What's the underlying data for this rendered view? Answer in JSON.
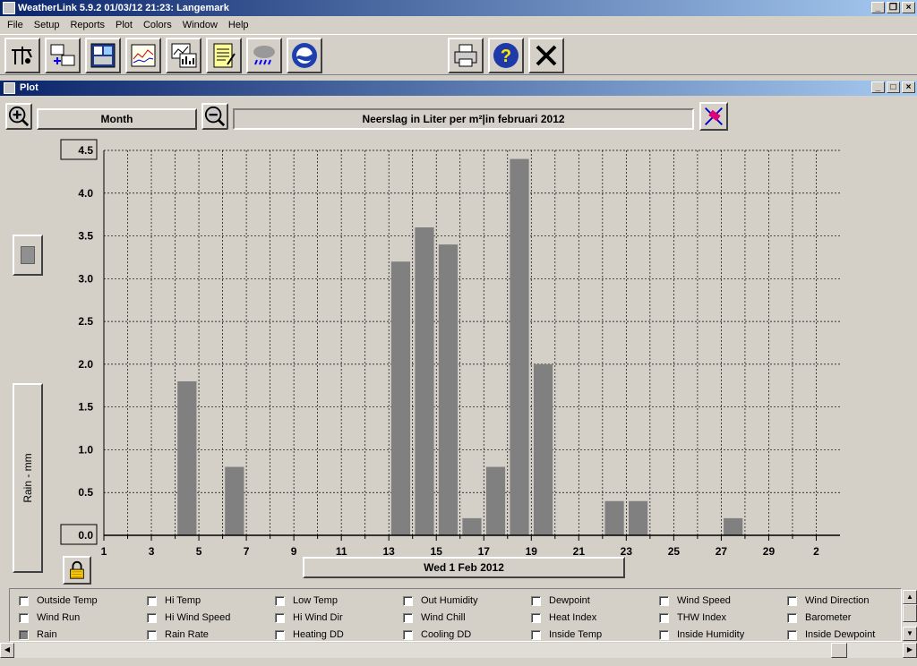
{
  "window": {
    "title": "WeatherLink 5.9.2  01/03/12  21:23: Langemark"
  },
  "menu": [
    "File",
    "Setup",
    "Reports",
    "Plot",
    "Colors",
    "Window",
    "Help"
  ],
  "toolbar_icons": [
    "station-icon",
    "transfer-icon",
    "bulletin-icon",
    "strip-chart-icon",
    "plot-icon",
    "notes-icon",
    "weather-icon",
    "noaa-icon",
    "print-icon",
    "help-icon",
    "close-icon"
  ],
  "plot_window": {
    "title": "Plot"
  },
  "controls": {
    "period": "Month",
    "chart_title": "Neerslag in Liter per m²|in februari 2012",
    "date": "Wed 1 Feb 2012"
  },
  "chart_data": {
    "type": "bar",
    "ylabel": "Rain - mm",
    "ylim": [
      0,
      4.5
    ],
    "yticks": [
      "0.0",
      "0.5",
      "1.0",
      "1.5",
      "2.0",
      "2.5",
      "3.0",
      "3.5",
      "4.0",
      "4.5"
    ],
    "xticks": [
      "1",
      "3",
      "5",
      "7",
      "9",
      "11",
      "13",
      "15",
      "17",
      "19",
      "21",
      "23",
      "25",
      "27",
      "29",
      "2"
    ],
    "categories": [
      "1",
      "2",
      "3",
      "4",
      "5",
      "6",
      "7",
      "8",
      "9",
      "10",
      "11",
      "12",
      "13",
      "14",
      "15",
      "16",
      "17",
      "18",
      "19",
      "20",
      "21",
      "22",
      "23",
      "24",
      "25",
      "26",
      "27",
      "28",
      "29"
    ],
    "values": [
      0,
      0,
      0,
      1.8,
      0,
      0.8,
      0,
      0,
      0,
      0,
      0,
      0,
      3.2,
      3.6,
      3.4,
      0.2,
      0.8,
      4.4,
      2.0,
      0,
      0,
      0.4,
      0.4,
      0,
      0,
      0,
      0.2,
      0,
      0
    ],
    "bar_color": "#808080",
    "grid": true
  },
  "legend": [
    {
      "label": "Outside Temp",
      "checked": false
    },
    {
      "label": "Hi Temp",
      "checked": false
    },
    {
      "label": "Low Temp",
      "checked": false
    },
    {
      "label": "Out Humidity",
      "checked": false
    },
    {
      "label": "Dewpoint",
      "checked": false
    },
    {
      "label": "Wind Speed",
      "checked": false
    },
    {
      "label": "Wind Direction",
      "checked": false
    },
    {
      "label": "Wind Run",
      "checked": false
    },
    {
      "label": "Hi Wind Speed",
      "checked": false
    },
    {
      "label": "Hi Wind Dir",
      "checked": false
    },
    {
      "label": "Wind Chill",
      "checked": false
    },
    {
      "label": "Heat Index",
      "checked": false
    },
    {
      "label": "THW Index",
      "checked": false
    },
    {
      "label": "Barometer",
      "checked": false
    },
    {
      "label": "Rain",
      "checked": true
    },
    {
      "label": "Rain Rate",
      "checked": false
    },
    {
      "label": "Heating DD",
      "checked": false
    },
    {
      "label": "Cooling DD",
      "checked": false
    },
    {
      "label": "Inside Temp",
      "checked": false
    },
    {
      "label": "Inside Humidity",
      "checked": false
    },
    {
      "label": "Inside Dewpoint",
      "checked": false
    }
  ]
}
